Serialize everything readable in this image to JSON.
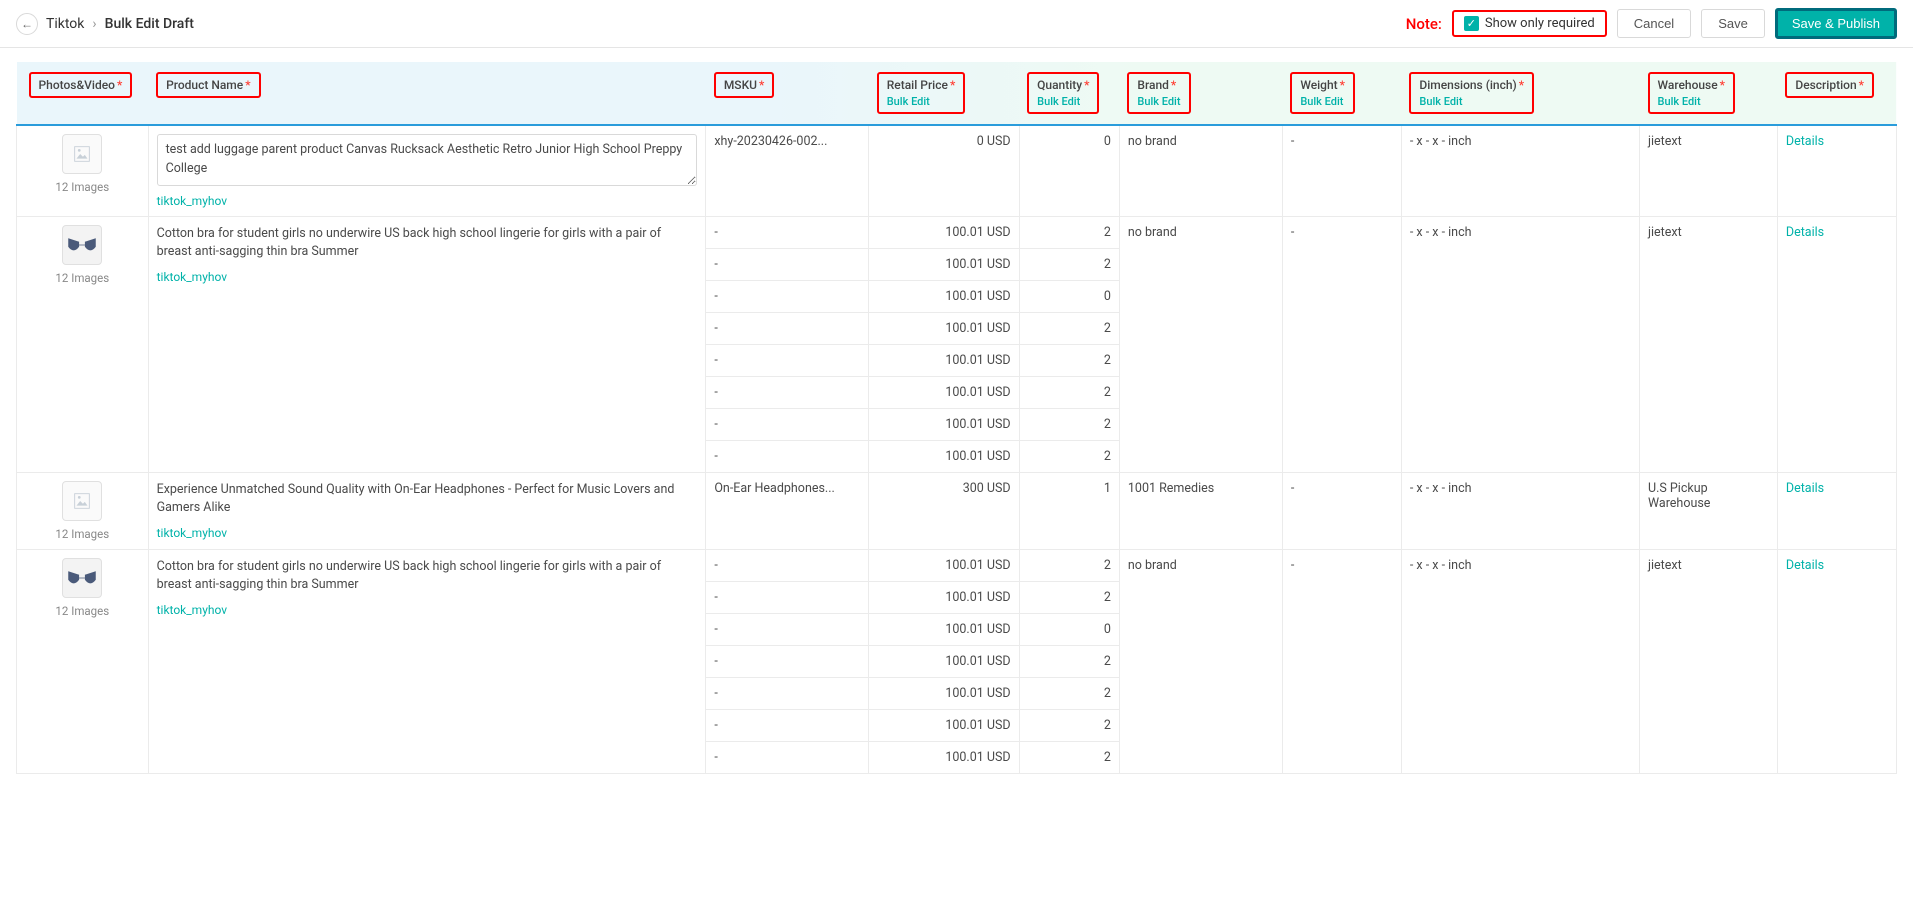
{
  "header": {
    "breadcrumb_parent": "Tiktok",
    "breadcrumb_current": "Bulk Edit Draft",
    "note_label": "Note:",
    "show_only_required_label": "Show only required",
    "show_only_required_checked": true,
    "cancel": "Cancel",
    "save": "Save",
    "save_publish": "Save & Publish"
  },
  "columns": {
    "photos": "Photos&Video",
    "name": "Product Name",
    "msku": "MSKU",
    "price": "Retail Price",
    "qty": "Quantity",
    "brand": "Brand",
    "weight": "Weight",
    "dim": "Dimensions (inch)",
    "wh": "Warehouse",
    "desc": "Description",
    "bulk_edit": "Bulk Edit"
  },
  "rows": [
    {
      "images_label": "12 Images",
      "thumb_type": "placeholder",
      "name": "test add luggage parent product Canvas Rucksack Aesthetic Retro Junior High School Preppy College",
      "name_editable": true,
      "store": "tiktok_myhov",
      "msku": "xhy-20230426-002...",
      "price": "0 USD",
      "qty": "0",
      "brand": "no brand",
      "weight": "-",
      "dim": "- x - x - inch",
      "wh": "jietext",
      "desc": "Details",
      "variants": []
    },
    {
      "images_label": "12 Images",
      "thumb_type": "bra",
      "name": "Cotton bra for student girls no underwire US back high school lingerie for girls with a pair of breast anti-sagging thin bra Summer",
      "name_editable": false,
      "store": "tiktok_myhov",
      "msku": "-",
      "price": "100.01 USD",
      "qty": "2",
      "brand": "no brand",
      "weight": "-",
      "dim": "- x - x - inch",
      "wh": "jietext",
      "desc": "Details",
      "variants": [
        {
          "msku": "-",
          "price": "100.01 USD",
          "qty": "2"
        },
        {
          "msku": "-",
          "price": "100.01 USD",
          "qty": "0"
        },
        {
          "msku": "-",
          "price": "100.01 USD",
          "qty": "2"
        },
        {
          "msku": "-",
          "price": "100.01 USD",
          "qty": "2"
        },
        {
          "msku": "-",
          "price": "100.01 USD",
          "qty": "2"
        },
        {
          "msku": "-",
          "price": "100.01 USD",
          "qty": "2"
        },
        {
          "msku": "-",
          "price": "100.01 USD",
          "qty": "2"
        }
      ]
    },
    {
      "images_label": "12 Images",
      "thumb_type": "placeholder",
      "name": "Experience Unmatched Sound Quality with On-Ear Headphones - Perfect for Music Lovers and Gamers Alike",
      "name_editable": false,
      "store": "tiktok_myhov",
      "msku": "On-Ear Headphones...",
      "price": "300 USD",
      "qty": "1",
      "brand": "1001 Remedies",
      "weight": "-",
      "dim": "- x - x - inch",
      "wh": "U.S Pickup Warehouse",
      "desc": "Details",
      "variants": []
    },
    {
      "images_label": "12 Images",
      "thumb_type": "bra",
      "name": "Cotton bra for student girls no underwire US back high school lingerie for girls with a pair of breast anti-sagging thin bra Summer",
      "name_editable": false,
      "store": "tiktok_myhov",
      "msku": "-",
      "price": "100.01 USD",
      "qty": "2",
      "brand": "no brand",
      "weight": "-",
      "dim": "- x - x - inch",
      "wh": "jietext",
      "desc": "Details",
      "variants": [
        {
          "msku": "-",
          "price": "100.01 USD",
          "qty": "2"
        },
        {
          "msku": "-",
          "price": "100.01 USD",
          "qty": "0"
        },
        {
          "msku": "-",
          "price": "100.01 USD",
          "qty": "2"
        },
        {
          "msku": "-",
          "price": "100.01 USD",
          "qty": "2"
        },
        {
          "msku": "-",
          "price": "100.01 USD",
          "qty": "2"
        },
        {
          "msku": "-",
          "price": "100.01 USD",
          "qty": "2"
        }
      ]
    }
  ]
}
